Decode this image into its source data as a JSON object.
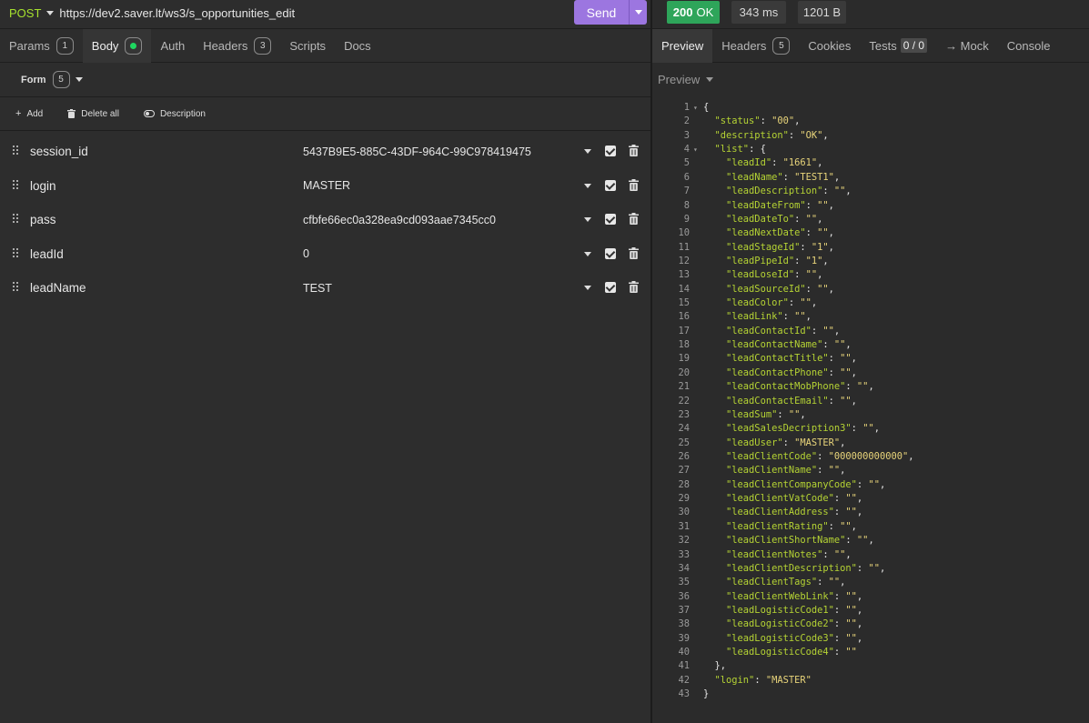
{
  "request": {
    "method": "POST",
    "url": "https://dev2.saver.lt/ws3/s_opportunities_edit",
    "send_label": "Send"
  },
  "request_tabs": [
    {
      "label": "Params",
      "badge": "1"
    },
    {
      "label": "Body",
      "dot": true
    },
    {
      "label": "Auth"
    },
    {
      "label": "Headers",
      "badge": "3"
    },
    {
      "label": "Scripts"
    },
    {
      "label": "Docs"
    }
  ],
  "body": {
    "form_label": "Form",
    "form_count": "5",
    "actions": {
      "add": "Add",
      "delete_all": "Delete all",
      "description": "Description"
    },
    "params": [
      {
        "name": "session_id",
        "value": "5437B9E5-885C-43DF-964C-99C978419475"
      },
      {
        "name": "login",
        "value": "MASTER"
      },
      {
        "name": "pass",
        "value": "cfbfe66ec0a328ea9cd093aae7345cc0"
      },
      {
        "name": "leadId",
        "value": "0"
      },
      {
        "name": "leadName",
        "value": "TEST"
      }
    ]
  },
  "response": {
    "status": "200 OK",
    "status_code": "200",
    "status_text": "OK",
    "time": "343 ms",
    "size": "1201 B",
    "tabs": [
      {
        "label": "Preview"
      },
      {
        "label": "Headers",
        "badge": "5"
      },
      {
        "label": "Cookies"
      },
      {
        "label": "Tests",
        "count": "0 / 0"
      },
      {
        "label": "→ Mock"
      },
      {
        "label": "Console"
      }
    ],
    "preview_mode": "Preview",
    "lines": [
      {
        "n": "1",
        "fold": true,
        "t": [
          [
            "p",
            "{"
          ]
        ]
      },
      {
        "n": "2",
        "t": [
          [
            "p",
            "  "
          ],
          [
            "k",
            "\"status\""
          ],
          [
            "p",
            ": "
          ],
          [
            "s",
            "\"00\""
          ],
          [
            "p",
            ","
          ]
        ]
      },
      {
        "n": "3",
        "t": [
          [
            "p",
            "  "
          ],
          [
            "k",
            "\"description\""
          ],
          [
            "p",
            ": "
          ],
          [
            "s",
            "\"OK\""
          ],
          [
            "p",
            ","
          ]
        ]
      },
      {
        "n": "4",
        "fold": true,
        "t": [
          [
            "p",
            "  "
          ],
          [
            "k",
            "\"list\""
          ],
          [
            "p",
            ": {"
          ]
        ]
      },
      {
        "n": "5",
        "t": [
          [
            "p",
            "    "
          ],
          [
            "k",
            "\"leadId\""
          ],
          [
            "p",
            ": "
          ],
          [
            "s",
            "\"1661\""
          ],
          [
            "p",
            ","
          ]
        ]
      },
      {
        "n": "6",
        "t": [
          [
            "p",
            "    "
          ],
          [
            "k",
            "\"leadName\""
          ],
          [
            "p",
            ": "
          ],
          [
            "s",
            "\"TEST1\""
          ],
          [
            "p",
            ","
          ]
        ]
      },
      {
        "n": "7",
        "t": [
          [
            "p",
            "    "
          ],
          [
            "k",
            "\"leadDescription\""
          ],
          [
            "p",
            ": "
          ],
          [
            "s",
            "\"\""
          ],
          [
            "p",
            ","
          ]
        ]
      },
      {
        "n": "8",
        "t": [
          [
            "p",
            "    "
          ],
          [
            "k",
            "\"leadDateFrom\""
          ],
          [
            "p",
            ": "
          ],
          [
            "s",
            "\"\""
          ],
          [
            "p",
            ","
          ]
        ]
      },
      {
        "n": "9",
        "t": [
          [
            "p",
            "    "
          ],
          [
            "k",
            "\"leadDateTo\""
          ],
          [
            "p",
            ": "
          ],
          [
            "s",
            "\"\""
          ],
          [
            "p",
            ","
          ]
        ]
      },
      {
        "n": "10",
        "t": [
          [
            "p",
            "    "
          ],
          [
            "k",
            "\"leadNextDate\""
          ],
          [
            "p",
            ": "
          ],
          [
            "s",
            "\"\""
          ],
          [
            "p",
            ","
          ]
        ]
      },
      {
        "n": "11",
        "t": [
          [
            "p",
            "    "
          ],
          [
            "k",
            "\"leadStageId\""
          ],
          [
            "p",
            ": "
          ],
          [
            "s",
            "\"1\""
          ],
          [
            "p",
            ","
          ]
        ]
      },
      {
        "n": "12",
        "t": [
          [
            "p",
            "    "
          ],
          [
            "k",
            "\"leadPipeId\""
          ],
          [
            "p",
            ": "
          ],
          [
            "s",
            "\"1\""
          ],
          [
            "p",
            ","
          ]
        ]
      },
      {
        "n": "13",
        "t": [
          [
            "p",
            "    "
          ],
          [
            "k",
            "\"leadLoseId\""
          ],
          [
            "p",
            ": "
          ],
          [
            "s",
            "\"\""
          ],
          [
            "p",
            ","
          ]
        ]
      },
      {
        "n": "14",
        "t": [
          [
            "p",
            "    "
          ],
          [
            "k",
            "\"leadSourceId\""
          ],
          [
            "p",
            ": "
          ],
          [
            "s",
            "\"\""
          ],
          [
            "p",
            ","
          ]
        ]
      },
      {
        "n": "15",
        "t": [
          [
            "p",
            "    "
          ],
          [
            "k",
            "\"leadColor\""
          ],
          [
            "p",
            ": "
          ],
          [
            "s",
            "\"\""
          ],
          [
            "p",
            ","
          ]
        ]
      },
      {
        "n": "16",
        "t": [
          [
            "p",
            "    "
          ],
          [
            "k",
            "\"leadLink\""
          ],
          [
            "p",
            ": "
          ],
          [
            "s",
            "\"\""
          ],
          [
            "p",
            ","
          ]
        ]
      },
      {
        "n": "17",
        "t": [
          [
            "p",
            "    "
          ],
          [
            "k",
            "\"leadContactId\""
          ],
          [
            "p",
            ": "
          ],
          [
            "s",
            "\"\""
          ],
          [
            "p",
            ","
          ]
        ]
      },
      {
        "n": "18",
        "t": [
          [
            "p",
            "    "
          ],
          [
            "k",
            "\"leadContactName\""
          ],
          [
            "p",
            ": "
          ],
          [
            "s",
            "\"\""
          ],
          [
            "p",
            ","
          ]
        ]
      },
      {
        "n": "19",
        "t": [
          [
            "p",
            "    "
          ],
          [
            "k",
            "\"leadContactTitle\""
          ],
          [
            "p",
            ": "
          ],
          [
            "s",
            "\"\""
          ],
          [
            "p",
            ","
          ]
        ]
      },
      {
        "n": "20",
        "t": [
          [
            "p",
            "    "
          ],
          [
            "k",
            "\"leadContactPhone\""
          ],
          [
            "p",
            ": "
          ],
          [
            "s",
            "\"\""
          ],
          [
            "p",
            ","
          ]
        ]
      },
      {
        "n": "21",
        "t": [
          [
            "p",
            "    "
          ],
          [
            "k",
            "\"leadContactMobPhone\""
          ],
          [
            "p",
            ": "
          ],
          [
            "s",
            "\"\""
          ],
          [
            "p",
            ","
          ]
        ]
      },
      {
        "n": "22",
        "t": [
          [
            "p",
            "    "
          ],
          [
            "k",
            "\"leadContactEmail\""
          ],
          [
            "p",
            ": "
          ],
          [
            "s",
            "\"\""
          ],
          [
            "p",
            ","
          ]
        ]
      },
      {
        "n": "23",
        "t": [
          [
            "p",
            "    "
          ],
          [
            "k",
            "\"leadSum\""
          ],
          [
            "p",
            ": "
          ],
          [
            "s",
            "\"\""
          ],
          [
            "p",
            ","
          ]
        ]
      },
      {
        "n": "24",
        "t": [
          [
            "p",
            "    "
          ],
          [
            "k",
            "\"leadSalesDecription3\""
          ],
          [
            "p",
            ": "
          ],
          [
            "s",
            "\"\""
          ],
          [
            "p",
            ","
          ]
        ]
      },
      {
        "n": "25",
        "t": [
          [
            "p",
            "    "
          ],
          [
            "k",
            "\"leadUser\""
          ],
          [
            "p",
            ": "
          ],
          [
            "s",
            "\"MASTER\""
          ],
          [
            "p",
            ","
          ]
        ]
      },
      {
        "n": "26",
        "t": [
          [
            "p",
            "    "
          ],
          [
            "k",
            "\"leadClientCode\""
          ],
          [
            "p",
            ": "
          ],
          [
            "s",
            "\"000000000000\""
          ],
          [
            "p",
            ","
          ]
        ]
      },
      {
        "n": "27",
        "t": [
          [
            "p",
            "    "
          ],
          [
            "k",
            "\"leadClientName\""
          ],
          [
            "p",
            ": "
          ],
          [
            "s",
            "\"\""
          ],
          [
            "p",
            ","
          ]
        ]
      },
      {
        "n": "28",
        "t": [
          [
            "p",
            "    "
          ],
          [
            "k",
            "\"leadClientCompanyCode\""
          ],
          [
            "p",
            ": "
          ],
          [
            "s",
            "\"\""
          ],
          [
            "p",
            ","
          ]
        ]
      },
      {
        "n": "29",
        "t": [
          [
            "p",
            "    "
          ],
          [
            "k",
            "\"leadClientVatCode\""
          ],
          [
            "p",
            ": "
          ],
          [
            "s",
            "\"\""
          ],
          [
            "p",
            ","
          ]
        ]
      },
      {
        "n": "30",
        "t": [
          [
            "p",
            "    "
          ],
          [
            "k",
            "\"leadClientAddress\""
          ],
          [
            "p",
            ": "
          ],
          [
            "s",
            "\"\""
          ],
          [
            "p",
            ","
          ]
        ]
      },
      {
        "n": "31",
        "t": [
          [
            "p",
            "    "
          ],
          [
            "k",
            "\"leadClientRating\""
          ],
          [
            "p",
            ": "
          ],
          [
            "s",
            "\"\""
          ],
          [
            "p",
            ","
          ]
        ]
      },
      {
        "n": "32",
        "t": [
          [
            "p",
            "    "
          ],
          [
            "k",
            "\"leadClientShortName\""
          ],
          [
            "p",
            ": "
          ],
          [
            "s",
            "\"\""
          ],
          [
            "p",
            ","
          ]
        ]
      },
      {
        "n": "33",
        "t": [
          [
            "p",
            "    "
          ],
          [
            "k",
            "\"leadClientNotes\""
          ],
          [
            "p",
            ": "
          ],
          [
            "s",
            "\"\""
          ],
          [
            "p",
            ","
          ]
        ]
      },
      {
        "n": "34",
        "t": [
          [
            "p",
            "    "
          ],
          [
            "k",
            "\"leadClientDescription\""
          ],
          [
            "p",
            ": "
          ],
          [
            "s",
            "\"\""
          ],
          [
            "p",
            ","
          ]
        ]
      },
      {
        "n": "35",
        "t": [
          [
            "p",
            "    "
          ],
          [
            "k",
            "\"leadClientTags\""
          ],
          [
            "p",
            ": "
          ],
          [
            "s",
            "\"\""
          ],
          [
            "p",
            ","
          ]
        ]
      },
      {
        "n": "36",
        "t": [
          [
            "p",
            "    "
          ],
          [
            "k",
            "\"leadClientWebLink\""
          ],
          [
            "p",
            ": "
          ],
          [
            "s",
            "\"\""
          ],
          [
            "p",
            ","
          ]
        ]
      },
      {
        "n": "37",
        "t": [
          [
            "p",
            "    "
          ],
          [
            "k",
            "\"leadLogisticCode1\""
          ],
          [
            "p",
            ": "
          ],
          [
            "s",
            "\"\""
          ],
          [
            "p",
            ","
          ]
        ]
      },
      {
        "n": "38",
        "t": [
          [
            "p",
            "    "
          ],
          [
            "k",
            "\"leadLogisticCode2\""
          ],
          [
            "p",
            ": "
          ],
          [
            "s",
            "\"\""
          ],
          [
            "p",
            ","
          ]
        ]
      },
      {
        "n": "39",
        "t": [
          [
            "p",
            "    "
          ],
          [
            "k",
            "\"leadLogisticCode3\""
          ],
          [
            "p",
            ": "
          ],
          [
            "s",
            "\"\""
          ],
          [
            "p",
            ","
          ]
        ]
      },
      {
        "n": "40",
        "t": [
          [
            "p",
            "    "
          ],
          [
            "k",
            "\"leadLogisticCode4\""
          ],
          [
            "p",
            ": "
          ],
          [
            "s",
            "\"\""
          ]
        ]
      },
      {
        "n": "41",
        "t": [
          [
            "p",
            "  },"
          ]
        ]
      },
      {
        "n": "42",
        "t": [
          [
            "p",
            "  "
          ],
          [
            "k",
            "\"login\""
          ],
          [
            "p",
            ": "
          ],
          [
            "s",
            "\"MASTER\""
          ]
        ]
      },
      {
        "n": "43",
        "t": [
          [
            "p",
            "}"
          ]
        ]
      }
    ]
  }
}
